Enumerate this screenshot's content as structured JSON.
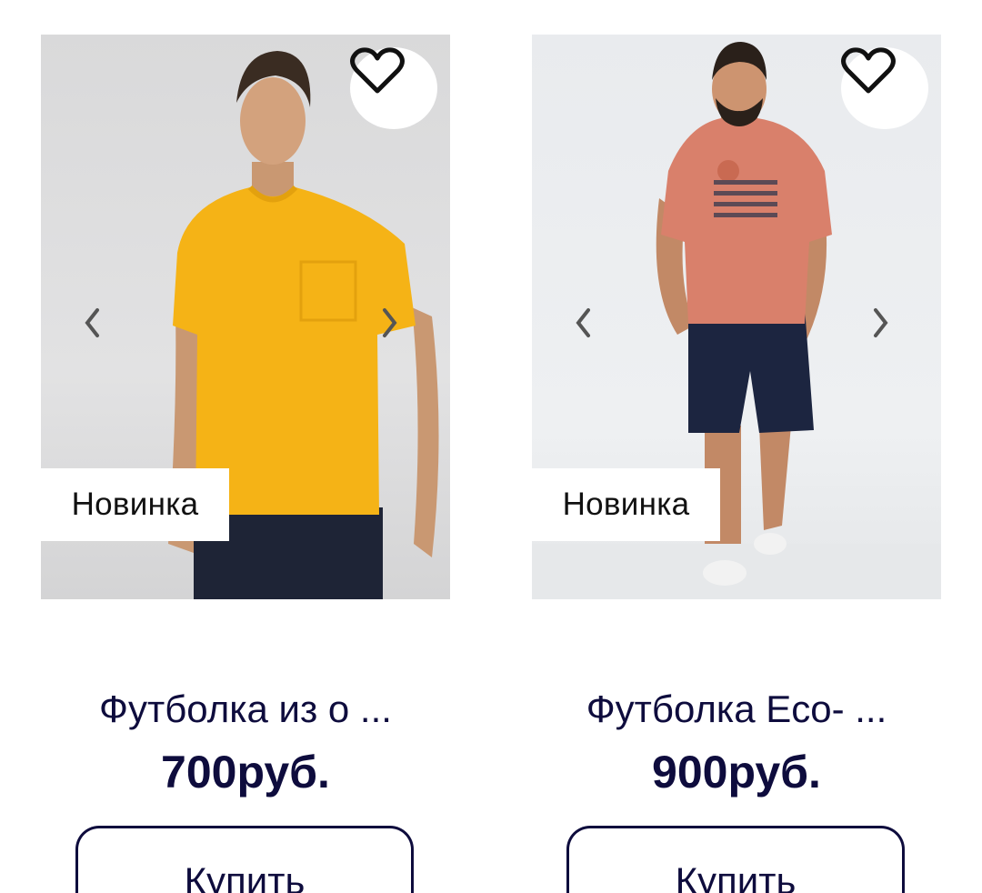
{
  "products": [
    {
      "badge": "Новинка",
      "title": "Футболка из о ...",
      "price": "700руб.",
      "buy_label": "Купить",
      "shirt_color": "#f5b316",
      "favorite_icon": "heart-outline-icon",
      "prev_glyph": "‹",
      "next_glyph": "›"
    },
    {
      "badge": "Новинка",
      "title": "Футболка Eco- ...",
      "price": "900руб.",
      "buy_label": "Купить",
      "shirt_color": "#d9806b",
      "favorite_icon": "heart-outline-icon",
      "prev_glyph": "‹",
      "next_glyph": "›"
    }
  ],
  "colors": {
    "text_primary": "#0e0c3d",
    "badge_bg": "#ffffff"
  }
}
